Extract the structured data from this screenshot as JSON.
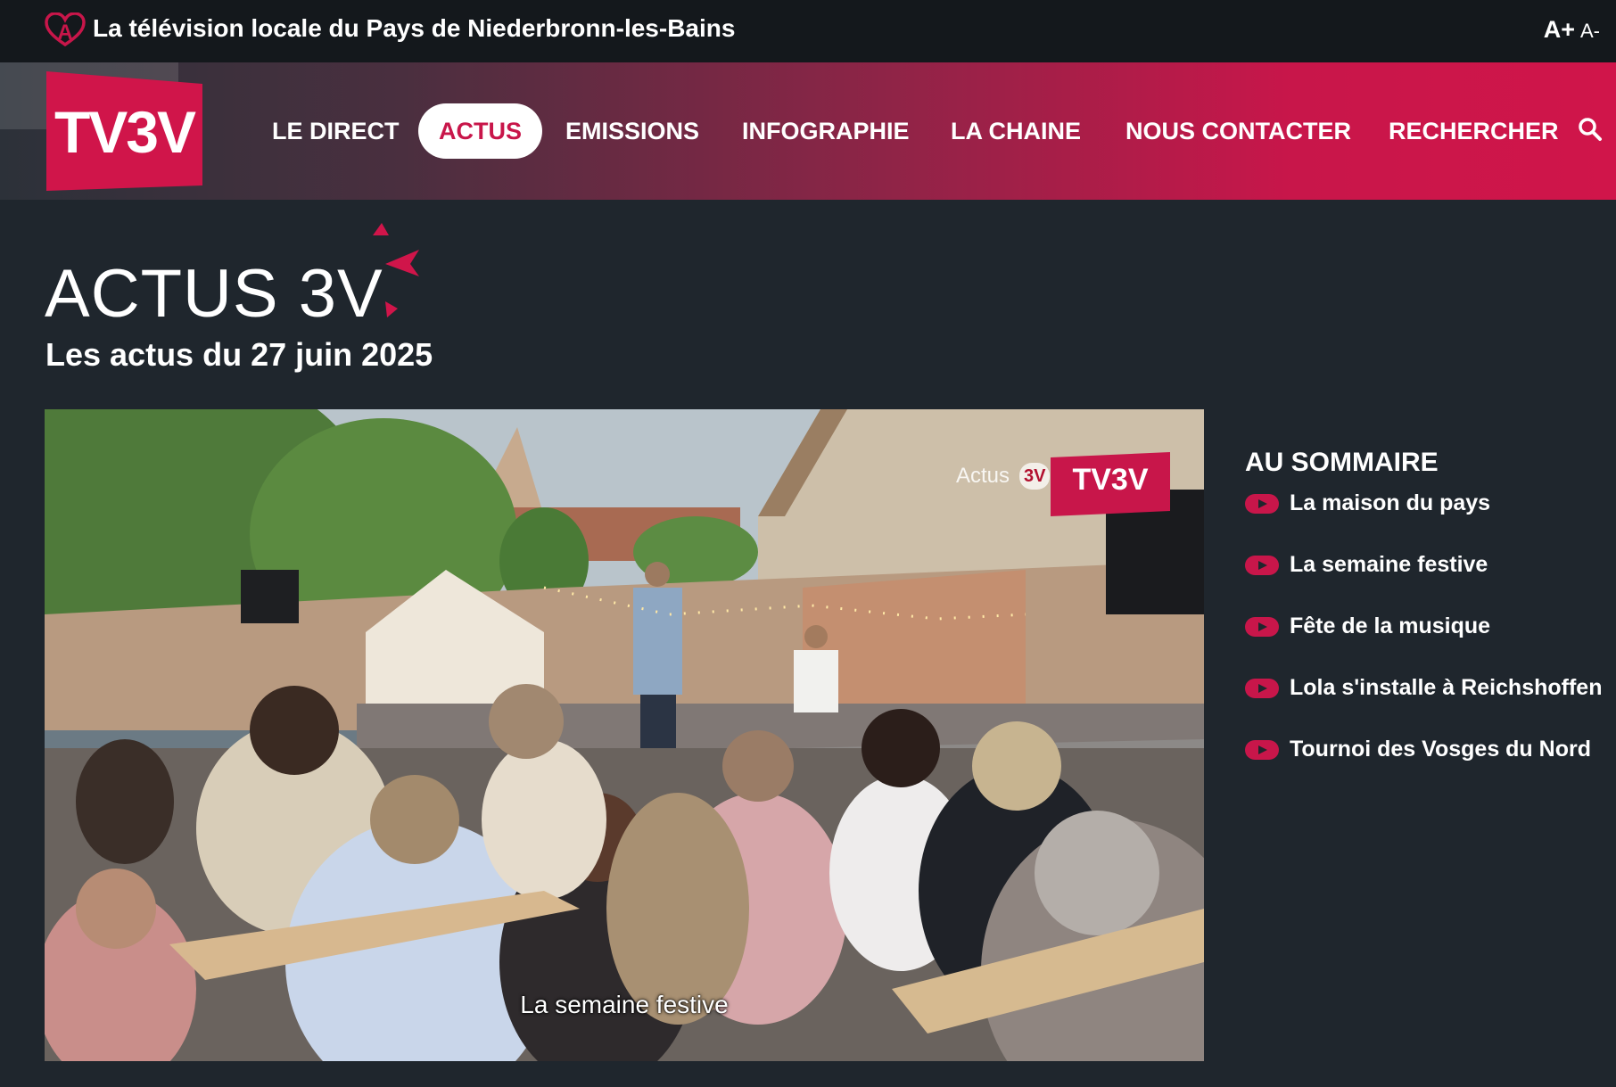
{
  "topbar": {
    "tagline": "La télévision locale du Pays de Niederbronn-les-Bains",
    "font_increase": "A+",
    "font_decrease": "A-"
  },
  "nav": {
    "logo_text": "TV3V",
    "items": [
      {
        "label": "LE DIRECT",
        "active": false
      },
      {
        "label": "ACTUS",
        "active": true
      },
      {
        "label": "EMISSIONS",
        "active": false
      },
      {
        "label": "INFOGRAPHIE",
        "active": false
      },
      {
        "label": "LA CHAINE",
        "active": false
      },
      {
        "label": "NOUS CONTACTER",
        "active": false
      },
      {
        "label": "RECHERCHER",
        "active": false,
        "icon": "search-icon"
      }
    ]
  },
  "page": {
    "title": "ACTUS 3V",
    "subtitle": "Les actus du 27 juin 2025"
  },
  "video": {
    "watermark_actus": "Actus",
    "watermark_3v": "3V",
    "watermark_logo": "TV3V",
    "caption": "La semaine festive"
  },
  "sommaire": {
    "title": "AU SOMMAIRE",
    "items": [
      {
        "label": "La maison du pays",
        "icon": "play-icon"
      },
      {
        "label": "La semaine festive",
        "icon": "play-icon"
      },
      {
        "label": "Fête de la musique",
        "icon": "play-icon"
      },
      {
        "label": "Lola s'installe à Reichshoffen",
        "icon": "play-icon"
      },
      {
        "label": "Tournoi des Vosges du Nord",
        "icon": "play-icon"
      }
    ]
  },
  "colors": {
    "brand": "#c8164a",
    "background": "#1f262d",
    "topbar": "#14181c"
  }
}
